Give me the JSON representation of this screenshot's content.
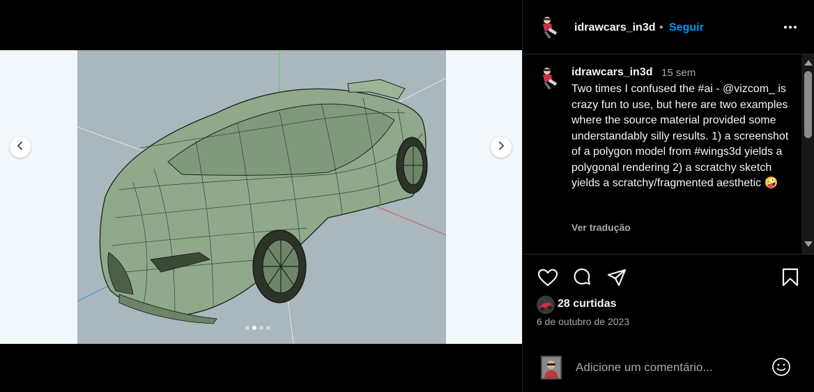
{
  "post": {
    "author": "idrawcars_in3d",
    "separator": "•",
    "follow_label": "Seguir",
    "more_icon": "more-horizontal-icon"
  },
  "caption": {
    "author": "idrawcars_in3d",
    "time": "15 sem",
    "text": "Two times I confused the #ai - @vizcom_ is crazy fun to use, but here are two examples where the source material provided some understandably silly results. 1) a screenshot of a polygon model from #wings3d yields a polygonal rendering 2) a scratchy sketch yields a scratchy/fragmented aesthetic 🤪",
    "translate_label": "Ver tradução"
  },
  "carousel": {
    "total": 4,
    "active_index": 1,
    "prev_icon": "chevron-left-icon",
    "next_icon": "chevron-right-icon"
  },
  "actions": {
    "like_icon": "heart-icon",
    "comment_icon": "comment-icon",
    "share_icon": "send-icon",
    "save_icon": "bookmark-icon"
  },
  "stats": {
    "likes": "28 curtidas",
    "date": "6 de outubro de 2023"
  },
  "composer": {
    "placeholder": "Adicione um comentário...",
    "emoji_icon": "emoji-icon"
  },
  "colors": {
    "background": "#000000",
    "accent": "#0095f6",
    "muted": "#a8a8a8",
    "divider": "#262626"
  }
}
